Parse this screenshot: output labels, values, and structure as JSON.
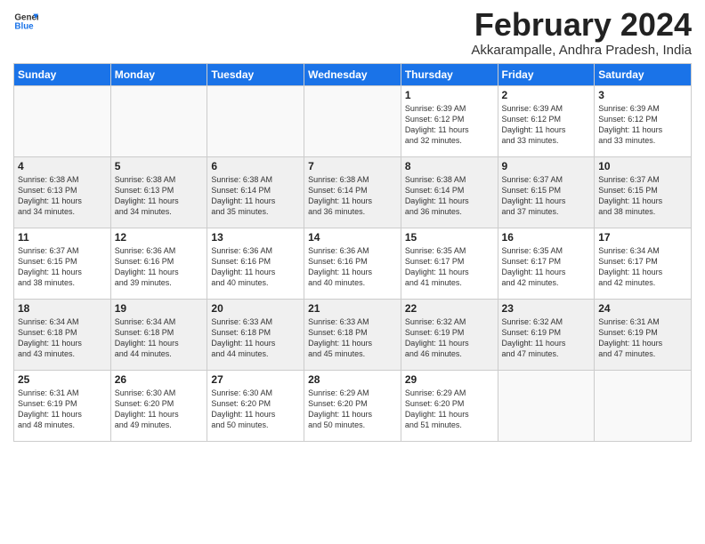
{
  "logo": {
    "line1": "General",
    "line2": "Blue"
  },
  "title": "February 2024",
  "location": "Akkarampalle, Andhra Pradesh, India",
  "days_of_week": [
    "Sunday",
    "Monday",
    "Tuesday",
    "Wednesday",
    "Thursday",
    "Friday",
    "Saturday"
  ],
  "weeks": [
    [
      {
        "day": "",
        "info": ""
      },
      {
        "day": "",
        "info": ""
      },
      {
        "day": "",
        "info": ""
      },
      {
        "day": "",
        "info": ""
      },
      {
        "day": "1",
        "info": "Sunrise: 6:39 AM\nSunset: 6:12 PM\nDaylight: 11 hours\nand 32 minutes."
      },
      {
        "day": "2",
        "info": "Sunrise: 6:39 AM\nSunset: 6:12 PM\nDaylight: 11 hours\nand 33 minutes."
      },
      {
        "day": "3",
        "info": "Sunrise: 6:39 AM\nSunset: 6:12 PM\nDaylight: 11 hours\nand 33 minutes."
      }
    ],
    [
      {
        "day": "4",
        "info": "Sunrise: 6:38 AM\nSunset: 6:13 PM\nDaylight: 11 hours\nand 34 minutes."
      },
      {
        "day": "5",
        "info": "Sunrise: 6:38 AM\nSunset: 6:13 PM\nDaylight: 11 hours\nand 34 minutes."
      },
      {
        "day": "6",
        "info": "Sunrise: 6:38 AM\nSunset: 6:14 PM\nDaylight: 11 hours\nand 35 minutes."
      },
      {
        "day": "7",
        "info": "Sunrise: 6:38 AM\nSunset: 6:14 PM\nDaylight: 11 hours\nand 36 minutes."
      },
      {
        "day": "8",
        "info": "Sunrise: 6:38 AM\nSunset: 6:14 PM\nDaylight: 11 hours\nand 36 minutes."
      },
      {
        "day": "9",
        "info": "Sunrise: 6:37 AM\nSunset: 6:15 PM\nDaylight: 11 hours\nand 37 minutes."
      },
      {
        "day": "10",
        "info": "Sunrise: 6:37 AM\nSunset: 6:15 PM\nDaylight: 11 hours\nand 38 minutes."
      }
    ],
    [
      {
        "day": "11",
        "info": "Sunrise: 6:37 AM\nSunset: 6:15 PM\nDaylight: 11 hours\nand 38 minutes."
      },
      {
        "day": "12",
        "info": "Sunrise: 6:36 AM\nSunset: 6:16 PM\nDaylight: 11 hours\nand 39 minutes."
      },
      {
        "day": "13",
        "info": "Sunrise: 6:36 AM\nSunset: 6:16 PM\nDaylight: 11 hours\nand 40 minutes."
      },
      {
        "day": "14",
        "info": "Sunrise: 6:36 AM\nSunset: 6:16 PM\nDaylight: 11 hours\nand 40 minutes."
      },
      {
        "day": "15",
        "info": "Sunrise: 6:35 AM\nSunset: 6:17 PM\nDaylight: 11 hours\nand 41 minutes."
      },
      {
        "day": "16",
        "info": "Sunrise: 6:35 AM\nSunset: 6:17 PM\nDaylight: 11 hours\nand 42 minutes."
      },
      {
        "day": "17",
        "info": "Sunrise: 6:34 AM\nSunset: 6:17 PM\nDaylight: 11 hours\nand 42 minutes."
      }
    ],
    [
      {
        "day": "18",
        "info": "Sunrise: 6:34 AM\nSunset: 6:18 PM\nDaylight: 11 hours\nand 43 minutes."
      },
      {
        "day": "19",
        "info": "Sunrise: 6:34 AM\nSunset: 6:18 PM\nDaylight: 11 hours\nand 44 minutes."
      },
      {
        "day": "20",
        "info": "Sunrise: 6:33 AM\nSunset: 6:18 PM\nDaylight: 11 hours\nand 44 minutes."
      },
      {
        "day": "21",
        "info": "Sunrise: 6:33 AM\nSunset: 6:18 PM\nDaylight: 11 hours\nand 45 minutes."
      },
      {
        "day": "22",
        "info": "Sunrise: 6:32 AM\nSunset: 6:19 PM\nDaylight: 11 hours\nand 46 minutes."
      },
      {
        "day": "23",
        "info": "Sunrise: 6:32 AM\nSunset: 6:19 PM\nDaylight: 11 hours\nand 47 minutes."
      },
      {
        "day": "24",
        "info": "Sunrise: 6:31 AM\nSunset: 6:19 PM\nDaylight: 11 hours\nand 47 minutes."
      }
    ],
    [
      {
        "day": "25",
        "info": "Sunrise: 6:31 AM\nSunset: 6:19 PM\nDaylight: 11 hours\nand 48 minutes."
      },
      {
        "day": "26",
        "info": "Sunrise: 6:30 AM\nSunset: 6:20 PM\nDaylight: 11 hours\nand 49 minutes."
      },
      {
        "day": "27",
        "info": "Sunrise: 6:30 AM\nSunset: 6:20 PM\nDaylight: 11 hours\nand 50 minutes."
      },
      {
        "day": "28",
        "info": "Sunrise: 6:29 AM\nSunset: 6:20 PM\nDaylight: 11 hours\nand 50 minutes."
      },
      {
        "day": "29",
        "info": "Sunrise: 6:29 AM\nSunset: 6:20 PM\nDaylight: 11 hours\nand 51 minutes."
      },
      {
        "day": "",
        "info": ""
      },
      {
        "day": "",
        "info": ""
      }
    ]
  ]
}
